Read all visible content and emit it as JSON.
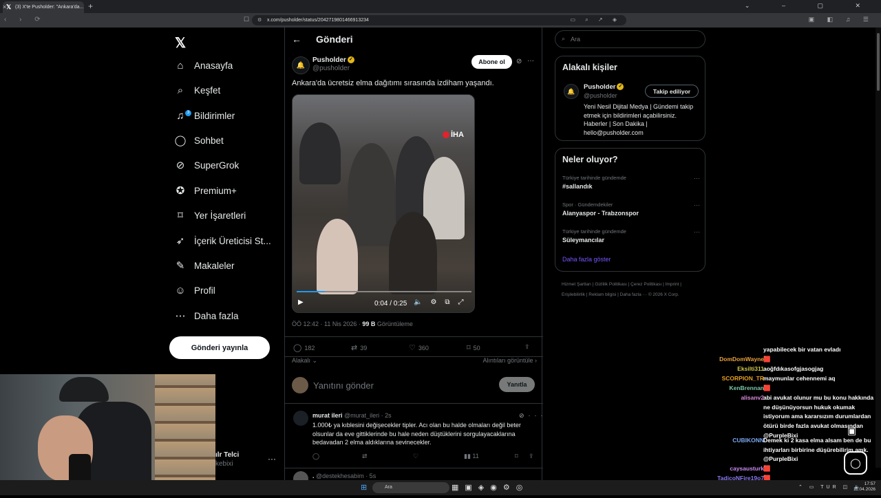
{
  "browser": {
    "tab_title": "(3) X'te Pusholder: \"Ankara'da...",
    "url": "x.com/pusholder/status/2042719801466913234"
  },
  "sidebar": {
    "items": [
      {
        "label": "Anasayfa",
        "icon": "home-icon"
      },
      {
        "label": "Keşfet",
        "icon": "search-icon"
      },
      {
        "label": "Bildirimler",
        "icon": "bell-icon",
        "badge": "3"
      },
      {
        "label": "Sohbet",
        "icon": "chat-icon"
      },
      {
        "label": "SuperGrok",
        "icon": "grok-icon"
      },
      {
        "label": "Premium+",
        "icon": "verified-icon"
      },
      {
        "label": "Yer İşaretleri",
        "icon": "bookmark-icon"
      },
      {
        "label": "İçerik Üreticisi St...",
        "icon": "rocket-icon"
      },
      {
        "label": "Makaleler",
        "icon": "article-icon"
      },
      {
        "label": "Profil",
        "icon": "person-icon"
      },
      {
        "label": "Daha fazla",
        "icon": "more-circle-icon"
      }
    ],
    "post_button": "Gönderi yayınla",
    "user_name": "ılr Telci",
    "user_handle": "kebixi"
  },
  "header": {
    "title": "Gönderi"
  },
  "post": {
    "author": "Pusholder",
    "handle": "@pusholder",
    "subscribe": "Abone ol",
    "text": "Ankara'da ücretsiz elma dağıtımı sırasında izdiham yaşandı.",
    "video": {
      "watermark": "İHA",
      "time": "0:04 / 0:25",
      "progress": 0.16
    },
    "timestamp": "ÖÖ 12:42 · 11 Nis 2026 · ",
    "views_count": "99 B",
    "views_label": " Görüntüleme",
    "replies": "182",
    "reposts": "39",
    "likes": "360",
    "bookmarks": "50",
    "relevant": "Alakalı",
    "quotes_link": "Alıntıları görüntüle"
  },
  "reply_box": {
    "placeholder": "Yanıtını gönder",
    "button": "Yanıtla"
  },
  "comments": [
    {
      "name": "murat ileri",
      "meta": " @murat_ileri · 2s",
      "text": "1.000₺ ya kıblesini değişecekler tipler. Acı olan bu halde olmaları değil beter olsunlar da eve gittiklerinde bu hale  neden düştüklerini sorgulayacaklarına bedavadan 2 elma aldıklarına sevinecekler.",
      "views": "11"
    },
    {
      "name": ".",
      "meta": " @destekhesabim · 5s"
    }
  ],
  "right": {
    "search_placeholder": "Ara",
    "related_title": "Alakalı kişiler",
    "related_name": "Pusholder",
    "related_handle": "@pusholder",
    "follow_label": "Takip ediliyor",
    "related_bio": "Yeni Nesil Dijital Medya | Gündemi takip etmek için bildirimleri açabilirsiniz. Haberler | Son Dakika | hello@pusholder.com",
    "trends_title": "Neler oluyor?",
    "trends": [
      {
        "context": "Türkiye tarihinde gündemde",
        "name": "#sallandık"
      },
      {
        "context": "Spor · Gündemdekiler",
        "name": "Alanyaspor - Trabzonspor"
      },
      {
        "context": "Türkiye tarihinde gündemde",
        "name": "Süleymancılar"
      }
    ],
    "show_more": "Daha fazla göster",
    "footer": "Hizmet Şartları  |  Gizlilik Politikası  |  Çerez Politikası  |  Imprint  |  Erişilebilirlik  |  Reklam bilgisi  |  Daha fazla ···  © 2026 X Corp."
  },
  "chat": [
    {
      "user": "",
      "msg": "yapabilecek bir vatan evladı",
      "color": "#ffffff"
    },
    {
      "user": "DomDomWayne",
      "msg": "🟥",
      "color": "#e8a23a"
    },
    {
      "user": "Eksilti311",
      "msg": "aoğfdıkasofgjasogjag",
      "color": "#d4c84a"
    },
    {
      "user": "SCORPION_TR",
      "msg": "maymunlar cehennemi aq",
      "color": "#e6a020"
    },
    {
      "user": "KenBrennan",
      "msg": "🟥",
      "color": "#7ec8a8"
    },
    {
      "user": "alisanv2",
      "msg": "abi avukat olunur mu bu konu hakkında ne düşünüyorsun hukuk okumak istiyorum ama kararsızım durumlardan ötürü birde fazla avukat olmasından @PurpleBixi",
      "color": "#d98ad8"
    },
    {
      "user": "CUBIKONN",
      "msg": "Demek ki 2 kasa elma alsam ben de bu ihtiyarları birbirine düşürebilirim amk. @PurpleBixi",
      "color": "#7aa8f0"
    },
    {
      "user": "caysausturk",
      "msg": "🟥",
      "color": "#c98af0"
    },
    {
      "user": "TadicoNFire19o7",
      "msg": "🟥",
      "color": "#8a7af0"
    },
    {
      "user": "KenBrennan",
      "msg": "",
      "color": "#7ec8a8"
    }
  ],
  "taskbar": {
    "search": "Ara",
    "lang": "TUR",
    "time": "17:57",
    "date": "11.04.2026"
  }
}
